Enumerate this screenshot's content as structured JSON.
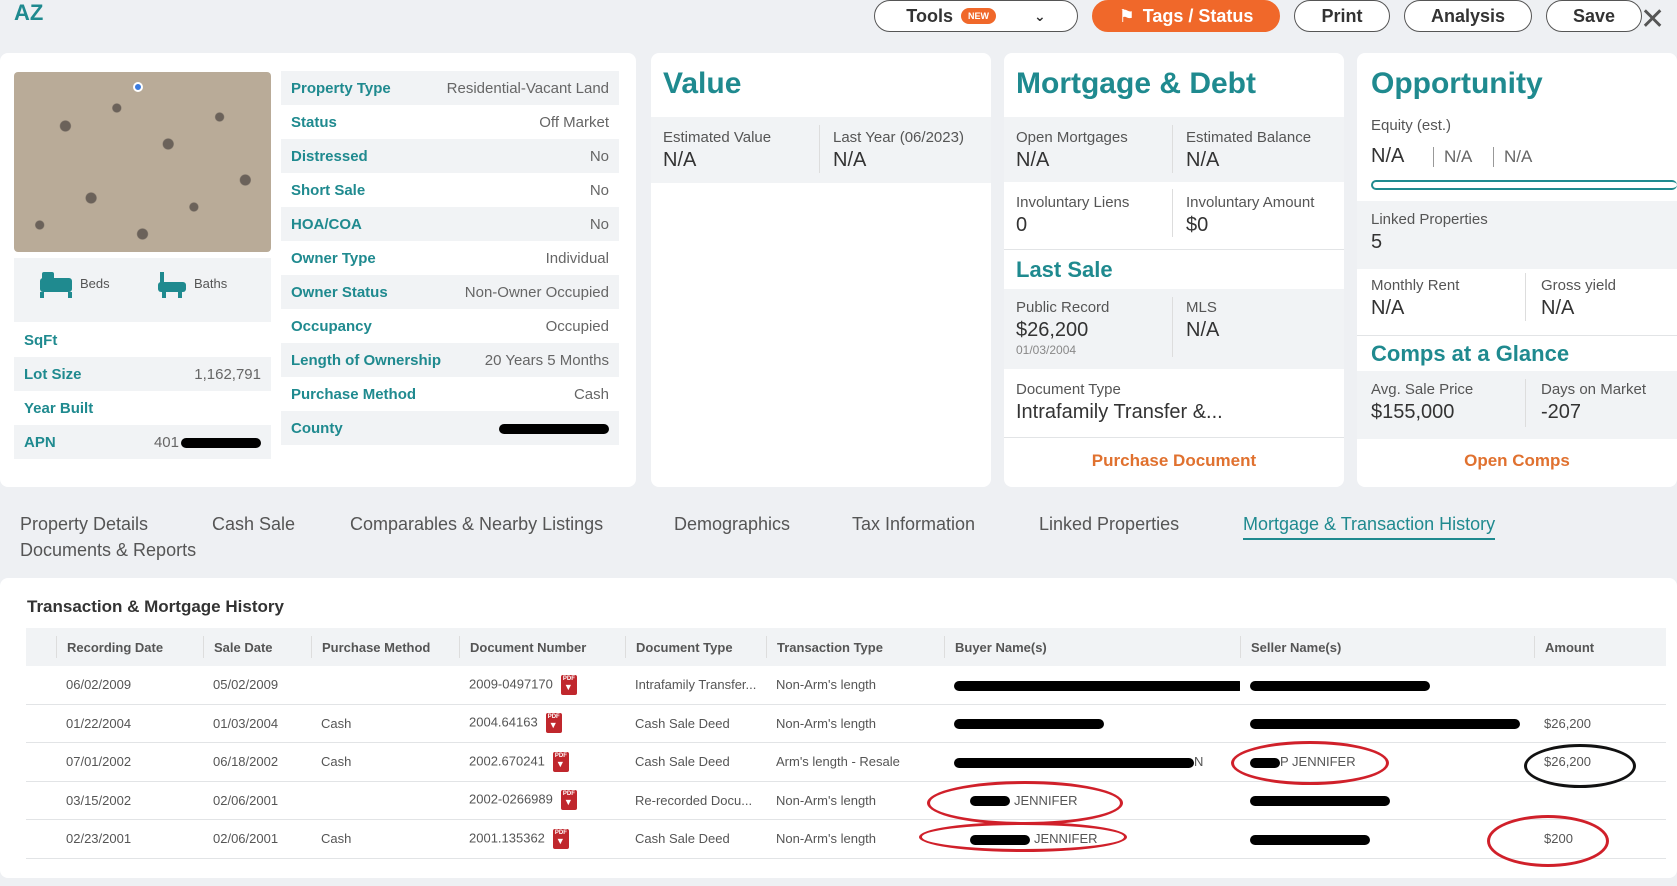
{
  "header": {
    "state": "AZ",
    "tools_label": "Tools",
    "tools_badge": "NEW",
    "tags_label": "Tags / Status",
    "print_label": "Print",
    "analysis_label": "Analysis",
    "save_label": "Save",
    "close_label": "✕"
  },
  "property": {
    "beds_label": "Beds",
    "baths_label": "Baths",
    "left_rows": [
      {
        "label": "SqFt",
        "value": ""
      },
      {
        "label": "Lot Size",
        "value": "1,162,791"
      },
      {
        "label": "Year Built",
        "value": ""
      },
      {
        "label": "APN",
        "value": "401"
      }
    ],
    "right_rows": [
      {
        "label": "Property Type",
        "value": "Residential-Vacant Land"
      },
      {
        "label": "Status",
        "value": "Off Market"
      },
      {
        "label": "Distressed",
        "value": "No"
      },
      {
        "label": "Short Sale",
        "value": "No"
      },
      {
        "label": "HOA/COA",
        "value": "No"
      },
      {
        "label": "Owner Type",
        "value": "Individual"
      },
      {
        "label": "Owner Status",
        "value": "Non-Owner Occupied"
      },
      {
        "label": "Occupancy",
        "value": "Occupied"
      },
      {
        "label": "Length of Ownership",
        "value": "20 Years 5 Months"
      },
      {
        "label": "Purchase Method",
        "value": "Cash"
      },
      {
        "label": "County",
        "value": ""
      }
    ]
  },
  "value_card": {
    "title": "Value",
    "est_label": "Estimated Value",
    "est_value": "N/A",
    "last_label": "Last Year (06/2023)",
    "last_value": "N/A"
  },
  "mortgage_card": {
    "title": "Mortgage & Debt",
    "open_label": "Open Mortgages",
    "open_value": "N/A",
    "balance_label": "Estimated Balance",
    "balance_value": "N/A",
    "liens_label": "Involuntary Liens",
    "liens_value": "0",
    "inv_amount_label": "Involuntary Amount",
    "inv_amount_value": "$0",
    "last_sale_title": "Last Sale",
    "public_label": "Public Record",
    "public_value": "$26,200",
    "public_date": "01/03/2004",
    "mls_label": "MLS",
    "mls_value": "N/A",
    "doc_type_label": "Document Type",
    "doc_type_value": "Intrafamily Transfer &...",
    "purchase_doc_link": "Purchase Document"
  },
  "opportunity_card": {
    "title": "Opportunity",
    "equity_label": "Equity (est.)",
    "equity_value": "N/A",
    "equity_v2": "N/A",
    "equity_v3": "N/A",
    "linked_label": "Linked Properties",
    "linked_value": "5",
    "rent_label": "Monthly Rent",
    "rent_value": "N/A",
    "yield_label": "Gross yield",
    "yield_value": "N/A",
    "comps_title": "Comps at a Glance",
    "avg_label": "Avg. Sale Price",
    "avg_value": "$155,000",
    "dom_label": "Days on Market",
    "dom_value": "-207",
    "open_comps_link": "Open Comps"
  },
  "tabs": [
    "Property Details",
    "Cash Sale",
    "Comparables & Nearby Listings",
    "Demographics",
    "Tax Information",
    "Linked Properties",
    "Mortgage & Transaction History",
    "Documents & Reports"
  ],
  "history": {
    "title": "Transaction & Mortgage History",
    "columns": [
      "Recording Date",
      "Sale Date",
      "Purchase Method",
      "Document Number",
      "Document Type",
      "Transaction Type",
      "Buyer Name(s)",
      "Seller Name(s)",
      "Amount"
    ],
    "rows": [
      {
        "rec": "06/02/2009",
        "sale": "05/02/2009",
        "method": "",
        "docnum": "2009-0497170",
        "doctype": "Intrafamily Transfer...",
        "trans": "Non-Arm's length",
        "buyer": "",
        "seller": "",
        "amount": ""
      },
      {
        "rec": "01/22/2004",
        "sale": "01/03/2004",
        "method": "Cash",
        "docnum": "2004.64163",
        "doctype": "Cash Sale Deed",
        "trans": "Non-Arm's length",
        "buyer": "",
        "seller": "",
        "amount": "$26,200"
      },
      {
        "rec": "07/01/2002",
        "sale": "06/18/2002",
        "method": "Cash",
        "docnum": "2002.670241",
        "doctype": "Cash Sale Deed",
        "trans": "Arm's length - Resale",
        "buyer": "N",
        "seller": "P JENNIFER",
        "amount": "$26,200"
      },
      {
        "rec": "03/15/2002",
        "sale": "02/06/2001",
        "method": "",
        "docnum": "2002-0266989",
        "doctype": "Re-recorded Docu...",
        "trans": "Non-Arm's length",
        "buyer": "JENNIFER",
        "seller": "",
        "amount": ""
      },
      {
        "rec": "02/23/2001",
        "sale": "02/06/2001",
        "method": "Cash",
        "docnum": "2001.135362",
        "doctype": "Cash Sale Deed",
        "trans": "Non-Arm's length",
        "buyer": "JENNIFER",
        "seller": "",
        "amount": "$200"
      }
    ]
  }
}
